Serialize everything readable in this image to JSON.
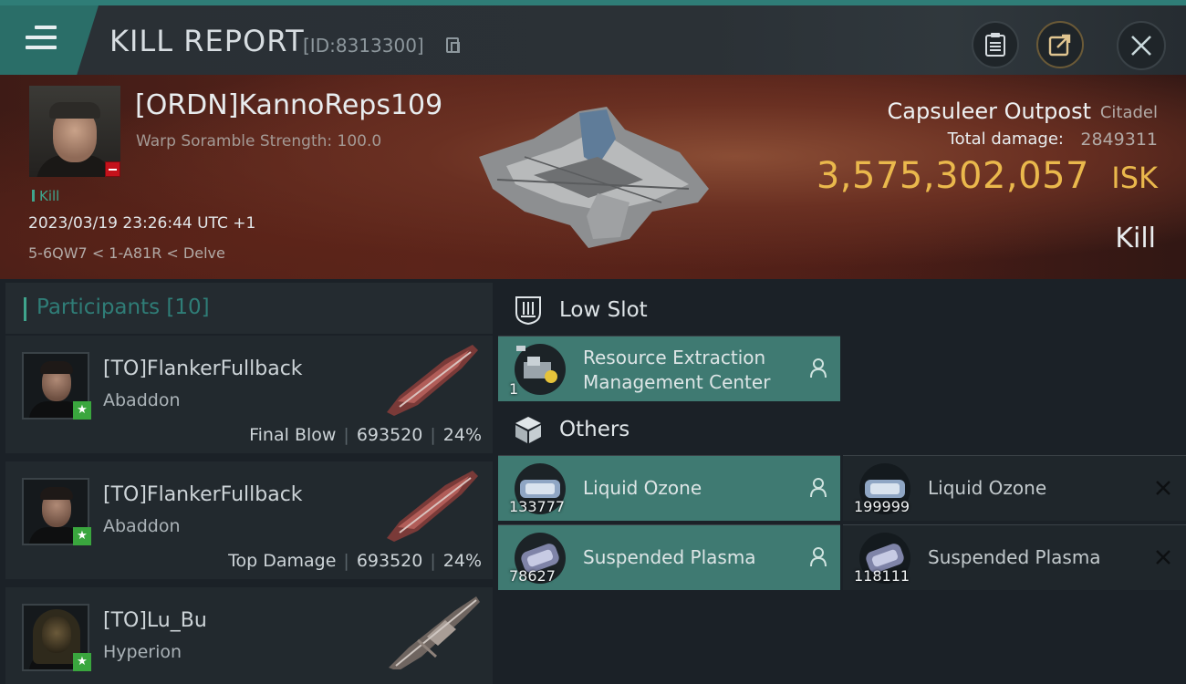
{
  "header": {
    "title": "KILL REPORT",
    "report_id": "[ID:8313300]"
  },
  "victim": {
    "name": "[ORDN]KannoReps109",
    "subtitle": "Warp Soramble Strength: 100.0",
    "tag": "Kill",
    "time": "2023/03/19 23:26:44 UTC +1",
    "location": "5-6QW7 < 1-A81R < Delve"
  },
  "target": {
    "name": "Capsuleer Outpost",
    "type": "Citadel",
    "total_damage_label": "Total damage:",
    "total_damage": "2849311",
    "isk_value": "3,575,302,057",
    "isk_unit": "ISK",
    "result": "Kill"
  },
  "participants": {
    "label": "Participants",
    "count": "[10]",
    "items": [
      {
        "name": "[TO]FlankerFullback",
        "ship": "Abaddon",
        "role": "Final Blow",
        "damage": "693520",
        "percent": "24%"
      },
      {
        "name": "[TO]FlankerFullback",
        "ship": "Abaddon",
        "role": "Top Damage",
        "damage": "693520",
        "percent": "24%"
      },
      {
        "name": "[TO]Lu_Bu",
        "ship": "Hyperion",
        "role": "",
        "damage": "",
        "percent": ""
      }
    ]
  },
  "slots": {
    "low_slot": {
      "label": "Low Slot",
      "items": [
        {
          "name_line1": "Resource Extraction",
          "name_line2": "Management Center",
          "qty": "1"
        }
      ]
    },
    "others": {
      "label": "Others",
      "items": [
        {
          "name": "Liquid Ozone",
          "qty": "133777"
        },
        {
          "name": "Liquid Ozone",
          "qty": "199999"
        },
        {
          "name": "Suspended Plasma",
          "qty": "78627"
        },
        {
          "name": "Suspended Plasma",
          "qty": "118111"
        }
      ]
    }
  },
  "colors": {
    "accent_teal": "#2f7d77",
    "isk_gold": "#eab84c",
    "owned_row": "#3f7a72"
  }
}
